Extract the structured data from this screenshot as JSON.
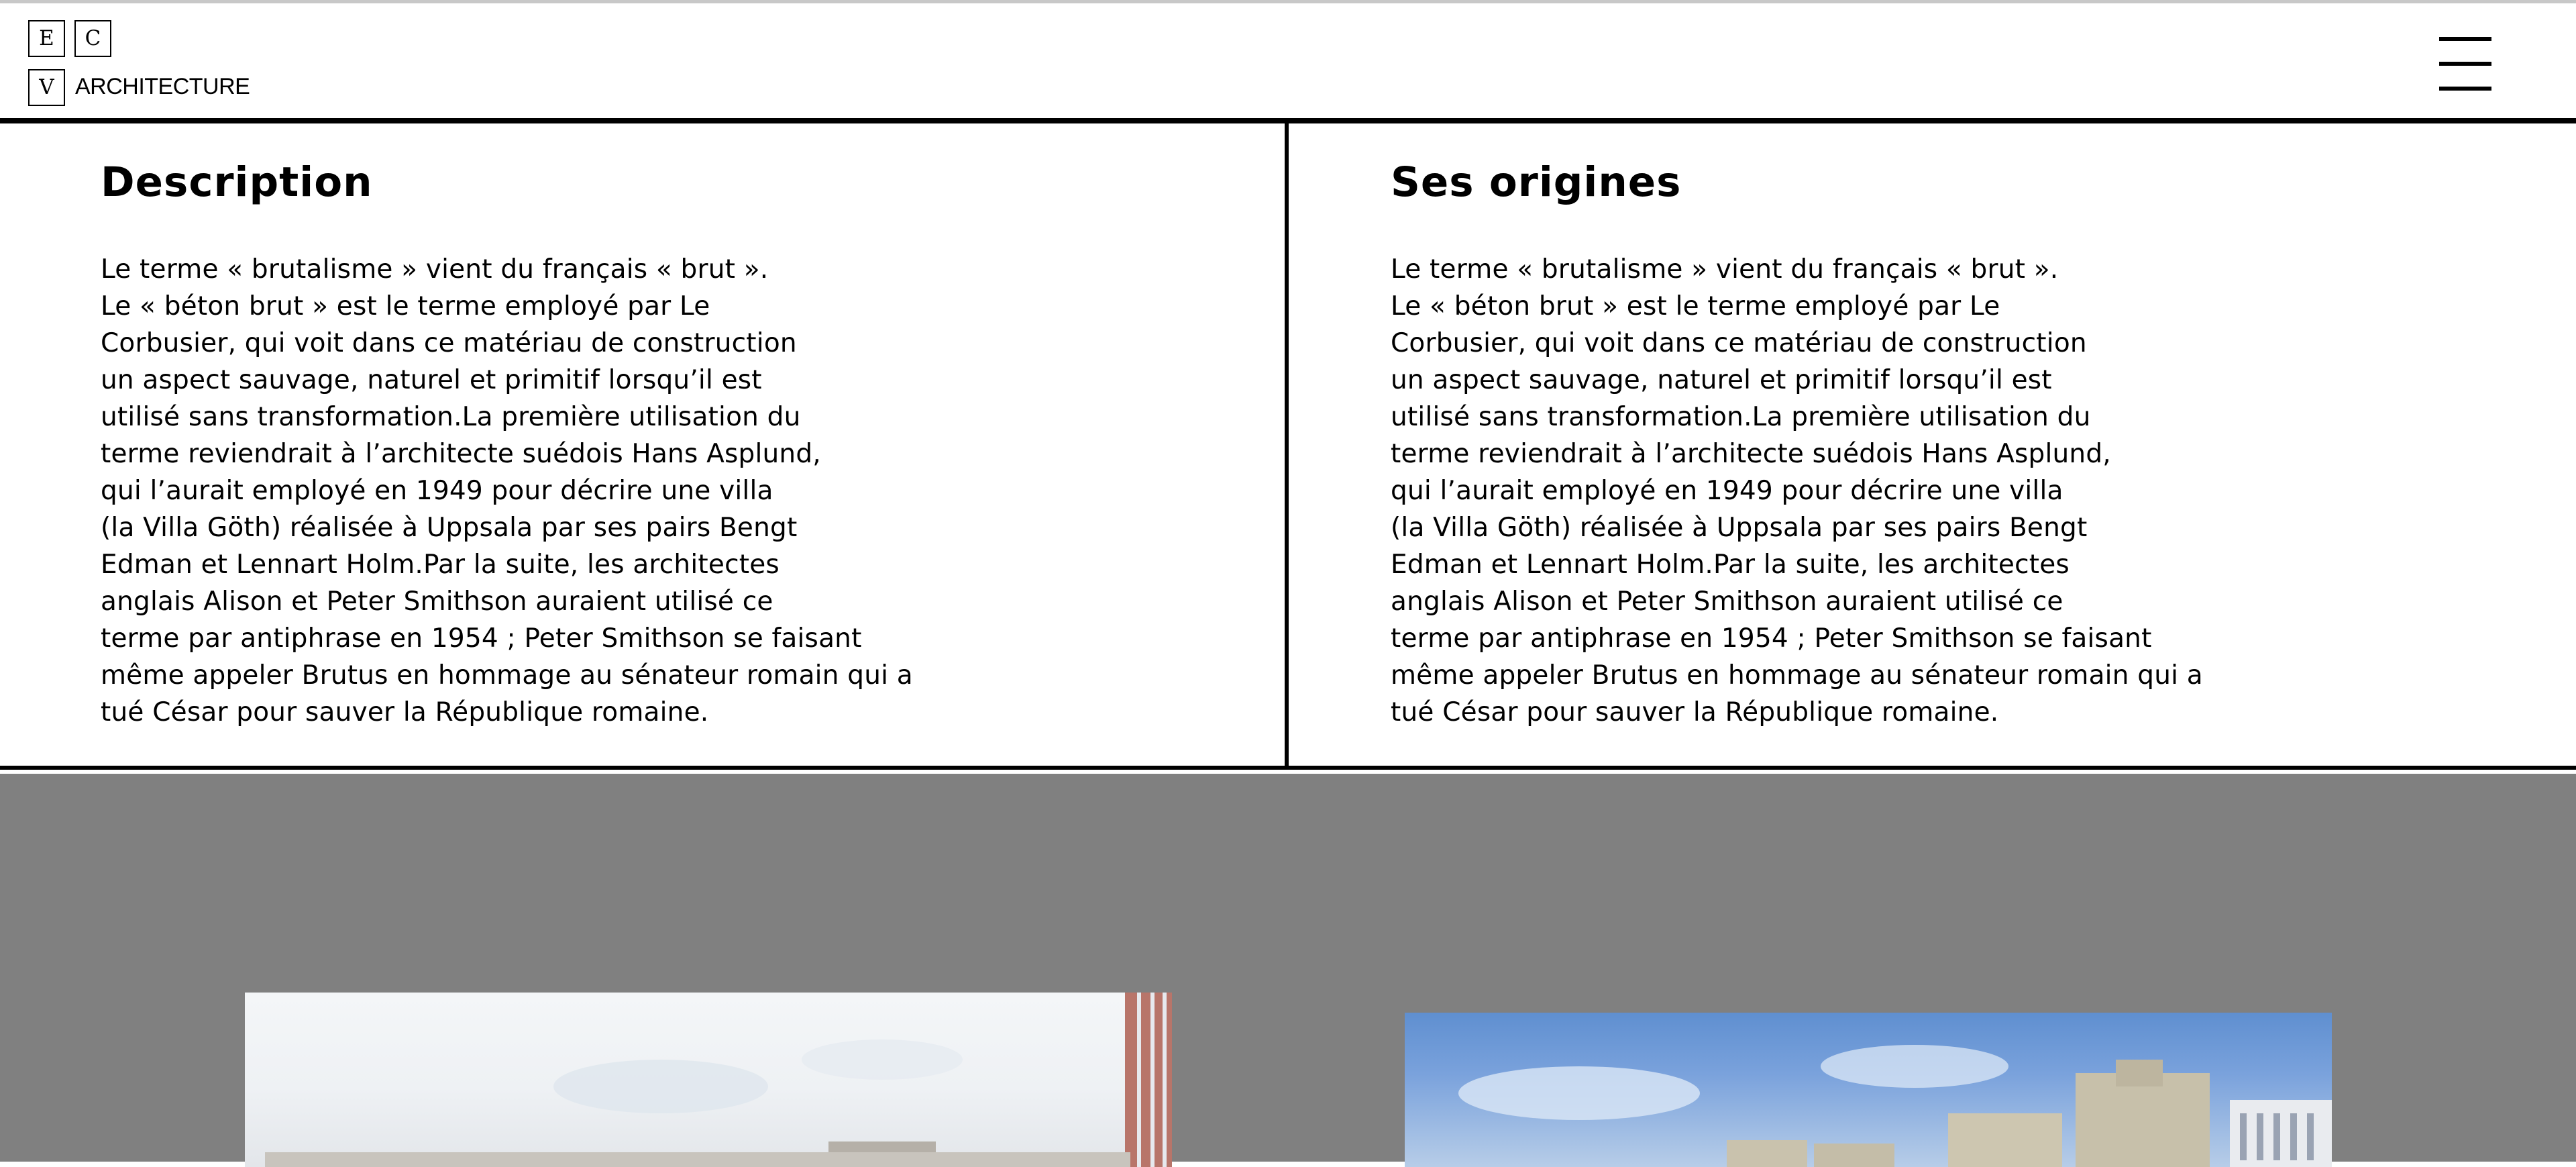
{
  "logo": {
    "letter_e": "E",
    "letter_c": "C",
    "letter_v": "V",
    "word": "ARCHITECTURE"
  },
  "menu": {
    "icon": "hamburger-menu-icon"
  },
  "sections": [
    {
      "title": "Description",
      "body": "Le terme « brutalisme » vient du français « brut ».\nLe « béton brut » est le terme employé par Le\nCorbusier, qui voit dans ce matériau de construction\nun aspect sauvage, naturel et primitif lorsqu’il est\nutilisé sans transformation.La première utilisation du\nterme reviendrait à l’architecte suédois Hans Asplund,\nqui l’aurait employé en 1949 pour décrire une villa\n(la Villa Göth) réalisée à Uppsala par ses pairs Bengt\nEdman et Lennart Holm.Par la suite, les architectes\nanglais Alison et Peter Smithson auraient utilisé ce\nterme par antiphrase en 1954 ; Peter Smithson se faisant\nmême appeler Brutus en hommage au sénateur romain qui a\ntué César pour sauver la République romaine."
    },
    {
      "title": "Ses origines",
      "body": "Le terme « brutalisme » vient du français « brut ».\nLe « béton brut » est le terme employé par Le\nCorbusier, qui voit dans ce matériau de construction\nun aspect sauvage, naturel et primitif lorsqu’il est\nutilisé sans transformation.La première utilisation du\nterme reviendrait à l’architecte suédois Hans Asplund,\nqui l’aurait employé en 1949 pour décrire une villa\n(la Villa Göth) réalisée à Uppsala par ses pairs Bengt\nEdman et Lennart Holm.Par la suite, les architectes\nanglais Alison et Peter Smithson auraient utilisé ce\nterme par antiphrase en 1954 ; Peter Smithson se faisant\nmême appeler Brutus en hommage au sénateur romain qui a\ntué César pour sauver la République romaine."
    }
  ],
  "colors": {
    "gallery_background": "#808080",
    "border": "#000000",
    "background": "#ffffff"
  }
}
